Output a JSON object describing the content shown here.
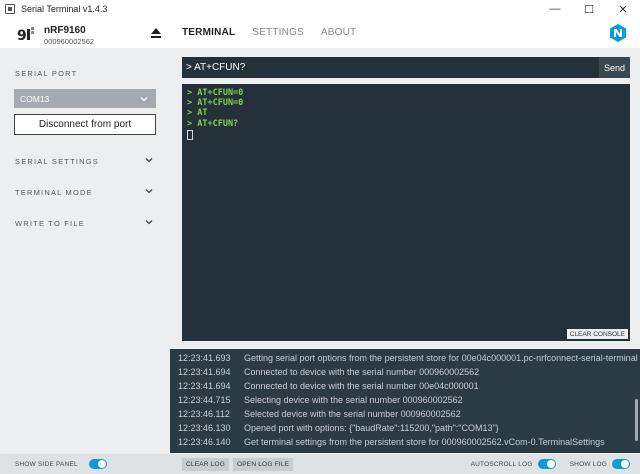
{
  "window": {
    "title": "Serial Terminal v1.4.3",
    "controls": {
      "minimize": "—",
      "maximize": "☐",
      "close": "✕"
    }
  },
  "device": {
    "name": "nRF9160",
    "serial": "000960002562"
  },
  "nav": {
    "tabs": [
      {
        "label": "TERMINAL",
        "active": true
      },
      {
        "label": "SETTINGS",
        "active": false
      },
      {
        "label": "ABOUT",
        "active": false
      }
    ]
  },
  "sidebar": {
    "serial_port_label": "SERIAL PORT",
    "port_selected": "COM13",
    "disconnect_label": "Disconnect from port",
    "sections": [
      {
        "label": "SERIAL SETTINGS"
      },
      {
        "label": "TERMINAL MODE"
      },
      {
        "label": "WRITE TO FILE"
      }
    ],
    "show_side_panel_label": "SHOW SIDE PANEL",
    "show_side_panel_on": true
  },
  "command": {
    "value": "> AT+CFUN?",
    "send_label": "Send"
  },
  "console": {
    "lines": [
      "> AT+CFUN=0",
      "> AT+CFUN=0",
      "> AT",
      "> AT+CFUN?"
    ],
    "clear_label": "CLEAR CONSOLE"
  },
  "log": {
    "entries": [
      {
        "time": "12:23:41.693",
        "message": "Getting serial port options from the persistent store for 00e04c000001.pc-nrfconnect-serial-terminal"
      },
      {
        "time": "12:23:41.694",
        "message": "Connected to device with the serial number 000960002562"
      },
      {
        "time": "12:23:41.694",
        "message": "Connected to device with the serial number 00e04c000001"
      },
      {
        "time": "12:23:44.715",
        "message": "Selecting device with the serial number 000960002562"
      },
      {
        "time": "12:23:46.112",
        "message": "Selected device with the serial number 000960002562"
      },
      {
        "time": "12:23:46.130",
        "message": "Opened port with options: {\"baudRate\":115200,\"path\":\"COM13\"}"
      },
      {
        "time": "12:23:46.140",
        "message": "Get terminal settings from the persistent store for 000960002562.vCom-0.TerminalSettings"
      }
    ]
  },
  "bottombar": {
    "clear_log_label": "CLEAR LOG",
    "open_log_file_label": "OPEN LOG FILE",
    "autoscroll_label": "AUTOSCROLL LOG",
    "autoscroll_on": true,
    "show_log_label": "SHOW LOG",
    "show_log_on": true
  },
  "colors": {
    "accent": "#0a9bd8",
    "console_bg": "#24303a",
    "log_bg": "#2c3a44",
    "console_text": "#7fd44a",
    "panel_bg": "#eceef0"
  }
}
